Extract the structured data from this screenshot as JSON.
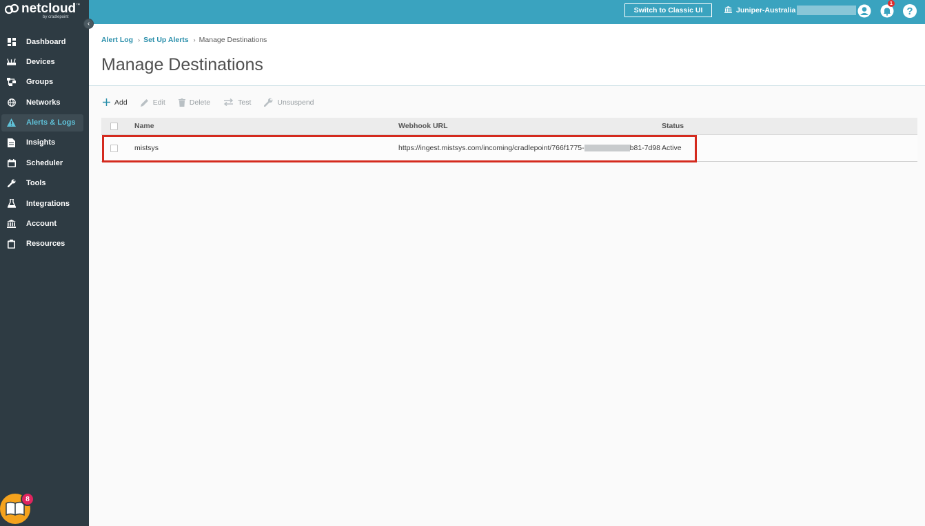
{
  "brand": {
    "name": "netcloud",
    "tm": "™",
    "sub": "by cradlepoint"
  },
  "sidebar": {
    "collapse_glyph": "‹",
    "items": [
      {
        "label": "Dashboard",
        "icon": "dashboard-icon"
      },
      {
        "label": "Devices",
        "icon": "router-icon"
      },
      {
        "label": "Groups",
        "icon": "groups-icon"
      },
      {
        "label": "Networks",
        "icon": "globe-icon"
      },
      {
        "label": "Alerts & Logs",
        "icon": "warning-icon",
        "active": true
      },
      {
        "label": "Insights",
        "icon": "document-icon"
      },
      {
        "label": "Scheduler",
        "icon": "calendar-icon"
      },
      {
        "label": "Tools",
        "icon": "wrench-icon"
      },
      {
        "label": "Integrations",
        "icon": "flask-icon"
      },
      {
        "label": "Account",
        "icon": "bank-icon"
      },
      {
        "label": "Resources",
        "icon": "clipboard-icon"
      }
    ],
    "help_badge_count": "8"
  },
  "topbar": {
    "classic_button": "Switch to Classic UI",
    "account_name": "Juniper-Australia",
    "notification_count": "1",
    "help_glyph": "?"
  },
  "breadcrumb": {
    "items": [
      "Alert Log",
      "Set Up Alerts"
    ],
    "separator": "›",
    "current": "Manage Destinations"
  },
  "page": {
    "title": "Manage Destinations"
  },
  "toolbar": {
    "add": "Add",
    "edit": "Edit",
    "delete": "Delete",
    "test": "Test",
    "unsuspend": "Unsuspend"
  },
  "table": {
    "columns": [
      "Name",
      "Webhook URL",
      "Status"
    ],
    "rows": [
      {
        "name": "mistsys",
        "url_prefix": "https://ingest.mistsys.com/incoming/cradlepoint/766f1775-",
        "url_suffix": "b81-7d98",
        "status": "Active"
      }
    ]
  },
  "colors": {
    "sidebar_bg": "#2e3b43",
    "topbar_bg": "#3aa3bf",
    "accent": "#2a8fab",
    "highlight": "#d42a1e",
    "launcher": "#f4a21d"
  }
}
